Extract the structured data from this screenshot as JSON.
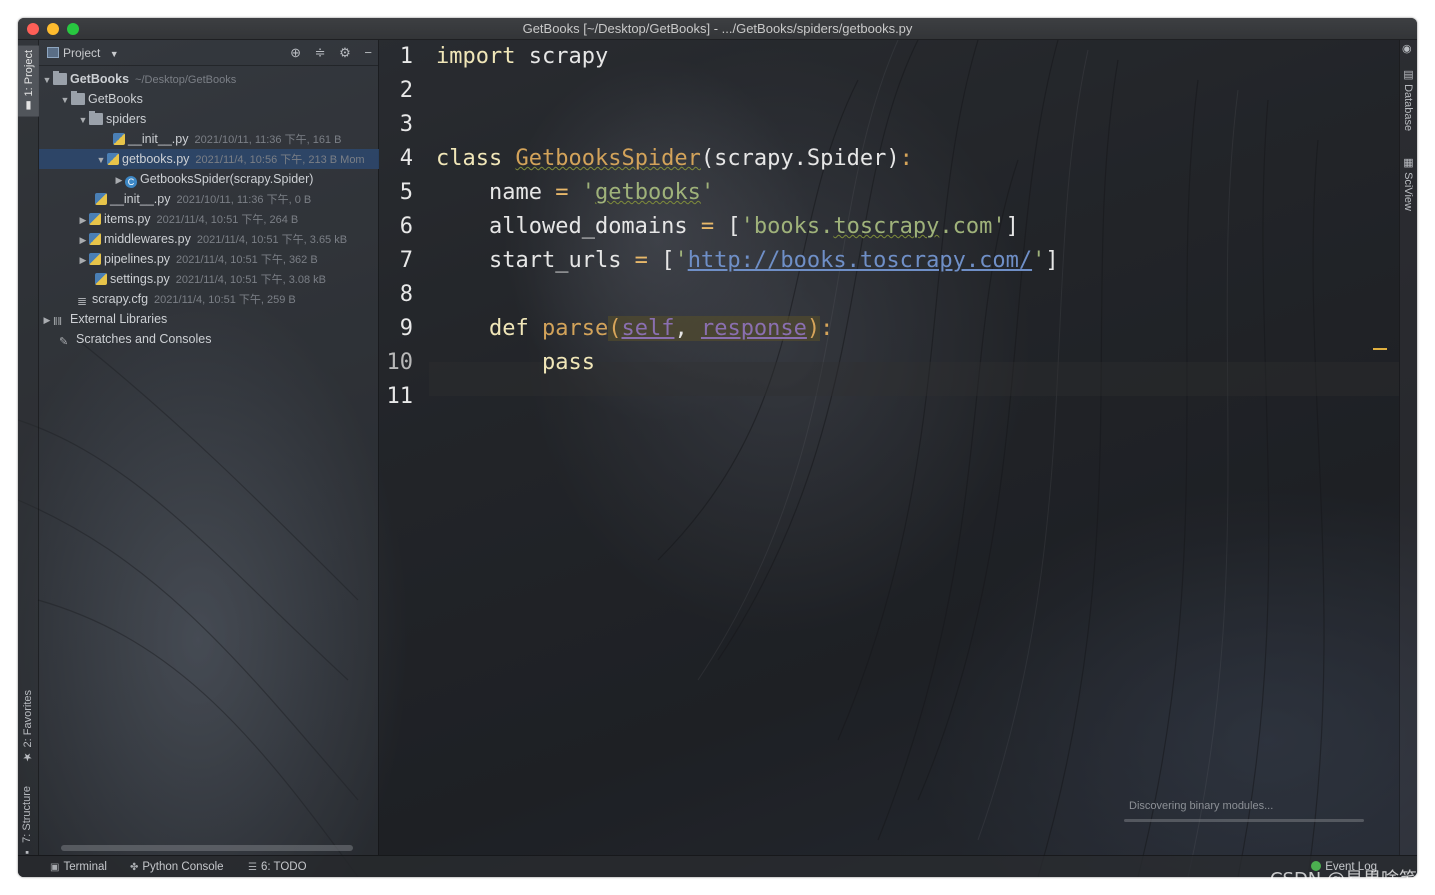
{
  "window": {
    "title": "GetBooks [~/Desktop/GetBooks] - .../GetBooks/spiders/getbooks.py"
  },
  "left_stripe": {
    "project_tab": "1: Project",
    "favorites_tab": "2: Favorites",
    "structure_tab": "7: Structure"
  },
  "right_stripe": {
    "database_tab": "Database",
    "sciview_tab": "SciView"
  },
  "project_panel": {
    "title": "Project",
    "tree": [
      {
        "label": "GetBooks",
        "meta": "~/Desktop/GetBooks"
      },
      {
        "label": "GetBooks",
        "meta": ""
      },
      {
        "label": "spiders",
        "meta": ""
      },
      {
        "label": "__init__.py",
        "meta": "2021/10/11, 11:36 下午, 161 B"
      },
      {
        "label": "getbooks.py",
        "meta": "2021/11/4, 10:56 下午, 213 B Mom"
      },
      {
        "label": "GetbooksSpider(scrapy.Spider)",
        "meta": ""
      },
      {
        "label": "__init__.py",
        "meta": "2021/10/11, 11:36 下午, 0 B"
      },
      {
        "label": "items.py",
        "meta": "2021/11/4, 10:51 下午, 264 B"
      },
      {
        "label": "middlewares.py",
        "meta": "2021/11/4, 10:51 下午, 3.65 kB"
      },
      {
        "label": "pipelines.py",
        "meta": "2021/11/4, 10:51 下午, 362 B"
      },
      {
        "label": "settings.py",
        "meta": "2021/11/4, 10:51 下午, 3.08 kB"
      },
      {
        "label": "scrapy.cfg",
        "meta": "2021/11/4, 10:51 下午, 259 B"
      },
      {
        "label": "External Libraries",
        "meta": ""
      },
      {
        "label": "Scratches and Consoles",
        "meta": ""
      }
    ]
  },
  "editor": {
    "line_numbers": [
      "1",
      "2",
      "3",
      "4",
      "5",
      "6",
      "7",
      "8",
      "9",
      "10",
      "11"
    ],
    "code": {
      "l1_kw": "import",
      "l1_rest": " scrapy",
      "l4_kw": "class",
      "l4_cls": "GetbooksSpider",
      "l4_rest": "(scrapy.Spider)",
      "l4_colon": ":",
      "l5_name": "name",
      "l5_eq": " = ",
      "l5_q1": "'",
      "l5_str": "getbooks",
      "l5_q2": "'",
      "l6_name": "allowed_domains",
      "l6_eq": " = ",
      "l6_open": "[",
      "l6_s1": "'books.",
      "l6_s2": "toscrapy",
      "l6_s3": ".com'",
      "l6_close": "]",
      "l7_name": "start_urls",
      "l7_eq": " = ",
      "l7_open": "[",
      "l7_q1": "'",
      "l7_url": "http://books.toscrapy.com/",
      "l7_q2": "'",
      "l7_close": "]",
      "l9_kw": "def",
      "l9_fn": "parse",
      "l9_open": "(",
      "l9_self": "self",
      "l9_comma": ", ",
      "l9_resp": "response",
      "l9_close": ")",
      "l9_colon": ":",
      "l10_kw": "pass"
    },
    "status_message": "Discovering binary modules..."
  },
  "bottom_bar": {
    "terminal": "Terminal",
    "python_console": "Python Console",
    "todo": "6: TODO",
    "event_log": "Event Log"
  },
  "watermark": "CSDN @易果啥笔",
  "colors": {
    "keyword": "#f0e6b8",
    "class_name": "#d3a35a",
    "string": "#9fb27a",
    "url": "#6f8fc7",
    "param": "#8a6fb0",
    "selection": "#2d486e"
  },
  "icons": [
    "folder-icon",
    "python-file-icon",
    "class-icon",
    "config-file-icon",
    "library-icon",
    "scratches-icon",
    "gear-icon",
    "crosshair-icon",
    "collapse-icon",
    "minimize-icon",
    "eye-icon",
    "star-icon"
  ]
}
